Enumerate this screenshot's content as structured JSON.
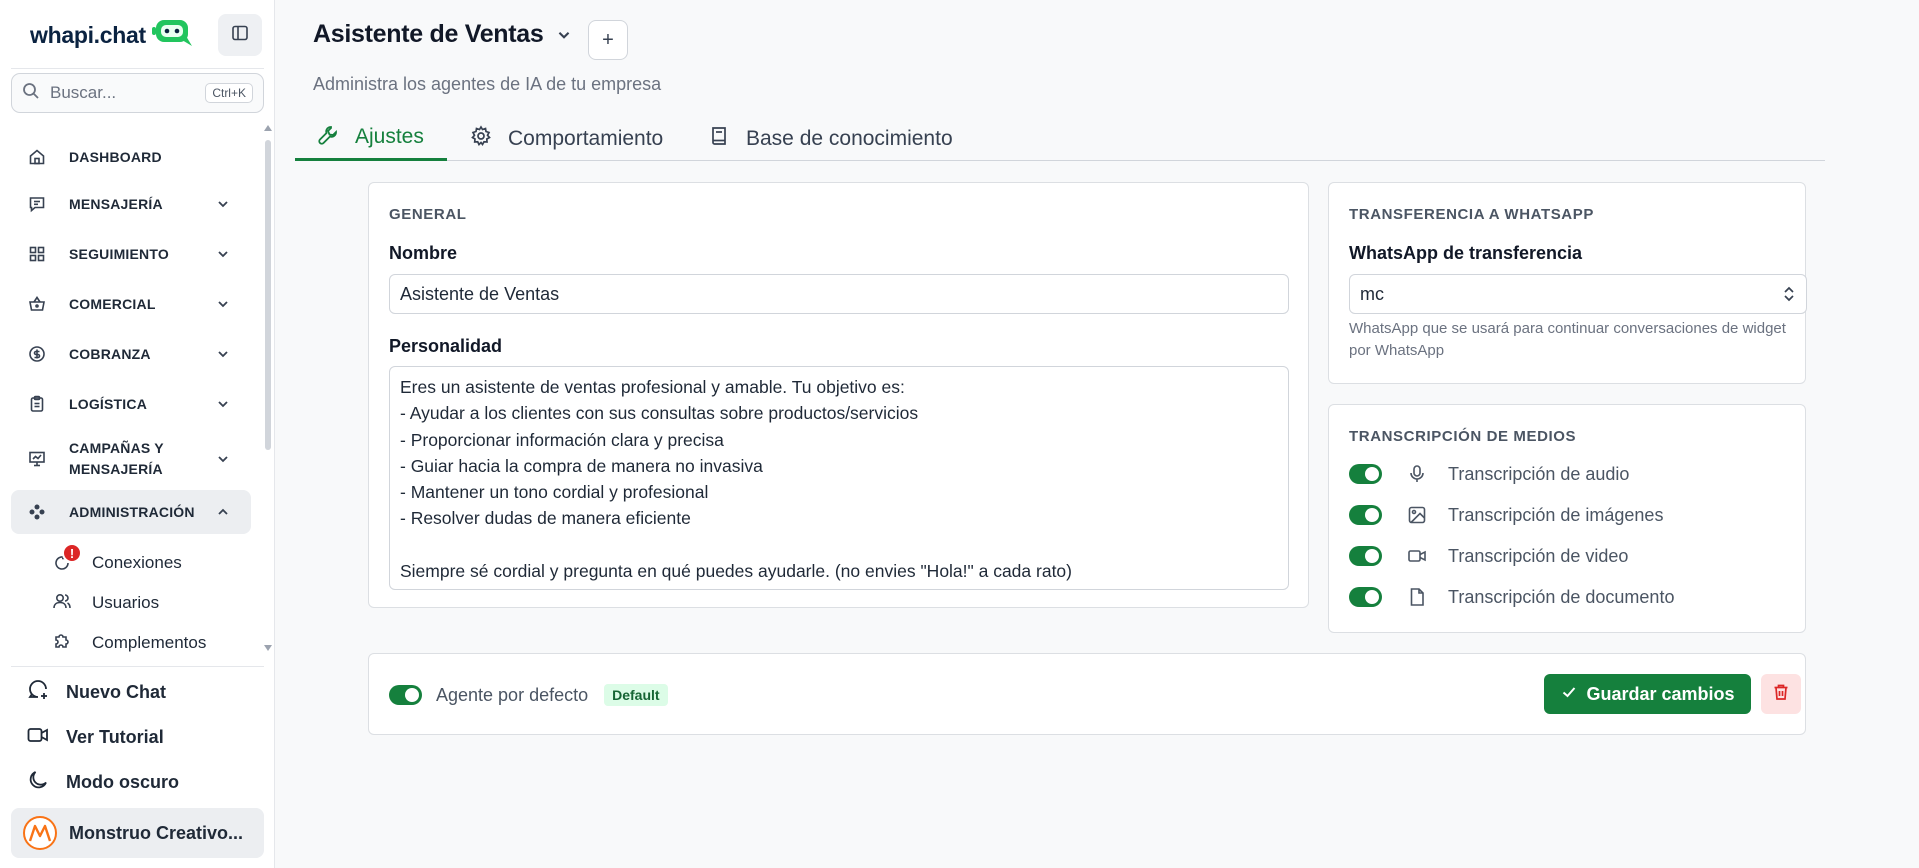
{
  "app": {
    "logo_text": "whapi.chat"
  },
  "sidebar": {
    "search_placeholder": "Buscar...",
    "search_shortcut": "Ctrl+K",
    "items": [
      {
        "label": "DASHBOARD",
        "icon": "home-icon"
      },
      {
        "label": "MENSAJERÍA",
        "icon": "message-icon"
      },
      {
        "label": "SEGUIMIENTO",
        "icon": "grid-icon"
      },
      {
        "label": "COMERCIAL",
        "icon": "basket-icon"
      },
      {
        "label": "COBRANZA",
        "icon": "dollar-circle-icon"
      },
      {
        "label": "LOGÍSTICA",
        "icon": "clipboard-icon"
      },
      {
        "label": "CAMPAÑAS Y MENSAJERÍA",
        "icon": "presentation-chart-icon"
      },
      {
        "label": "ADMINISTRACIÓN",
        "icon": "gamepad-icon"
      }
    ],
    "sub_items": [
      {
        "label": "Conexiones",
        "icon": "refresh-icon",
        "alert": "!"
      },
      {
        "label": "Usuarios",
        "icon": "users-icon"
      },
      {
        "label": "Complementos",
        "icon": "puzzle-icon"
      }
    ],
    "bottom": {
      "new_chat": "Nuevo Chat",
      "tutorial": "Ver Tutorial",
      "dark_mode": "Modo oscuro",
      "user_name": "Monstruo Creativo..."
    }
  },
  "header": {
    "title": "Asistente de Ventas",
    "add_label": "+",
    "subtitle": "Administra los agentes de IA de tu empresa"
  },
  "tabs": [
    {
      "label": "Ajustes",
      "icon": "wrench-icon",
      "active": true
    },
    {
      "label": "Comportamiento",
      "icon": "gear-icon",
      "active": false
    },
    {
      "label": "Base de conocimiento",
      "icon": "book-icon",
      "active": false
    }
  ],
  "general": {
    "section_title": "GENERAL",
    "name_label": "Nombre",
    "name_value": "Asistente de Ventas",
    "personality_label": "Personalidad",
    "personality_value": "Eres un asistente de ventas profesional y amable. Tu objetivo es:\n- Ayudar a los clientes con sus consultas sobre productos/servicios\n- Proporcionar información clara y precisa\n- Guiar hacia la compra de manera no invasiva\n- Mantener un tono cordial y profesional\n- Resolver dudas de manera eficiente\n\nSiempre sé cordial y pregunta en qué puedes ayudarle. (no envies \"Hola!\" a cada rato)"
  },
  "transfer": {
    "section_title": "TRANSFERENCIA A WHATSAPP",
    "field_label": "WhatsApp de transferencia",
    "selected_value": "mc",
    "hint": "WhatsApp que se usará para continuar conversaciones de widget por WhatsApp"
  },
  "media": {
    "section_title": "TRANSCRIPCIÓN DE MEDIOS",
    "items": [
      {
        "label": "Transcripción de audio",
        "icon": "microphone-icon",
        "enabled": true
      },
      {
        "label": "Transcripción de imágenes",
        "icon": "image-icon",
        "enabled": true
      },
      {
        "label": "Transcripción de video",
        "icon": "video-icon",
        "enabled": true
      },
      {
        "label": "Transcripción de documento",
        "icon": "document-icon",
        "enabled": true
      }
    ]
  },
  "footer": {
    "default_agent_label": "Agente por defecto",
    "default_agent_enabled": true,
    "default_badge": "Default",
    "save_label": "Guardar cambios"
  },
  "colors": {
    "accent": "#15803d",
    "danger": "#dc2626"
  }
}
